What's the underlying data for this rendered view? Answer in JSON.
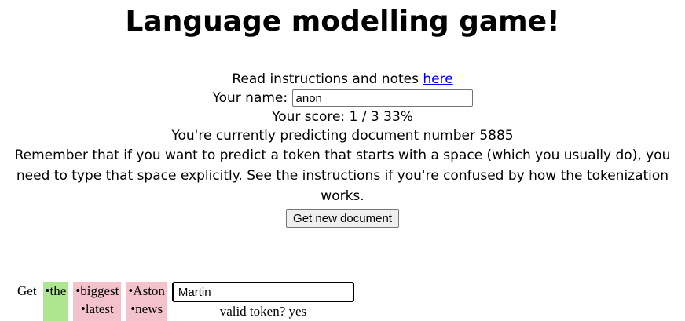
{
  "page": {
    "title": "Language modelling game!"
  },
  "instructions": {
    "prefix": "Read instructions and notes ",
    "link_text": "here"
  },
  "name": {
    "label": "Your name:",
    "value": "anon"
  },
  "score": {
    "text": "Your score: 1 / 3 33%"
  },
  "document": {
    "text": "You're currently predicting document number 5885"
  },
  "remember": {
    "text": "Remember that if you want to predict a token that starts with a space (which you usually do), you need to type that space explicitly. See the instructions if you're confused by how the tokenization works."
  },
  "actions": {
    "new_document_label": "Get new document"
  },
  "tokens": [
    {
      "text": "Get",
      "alt": ""
    },
    {
      "text": "•the",
      "alt": ""
    },
    {
      "text": "•biggest",
      "alt": "•latest"
    },
    {
      "text": "•Aston",
      "alt": "•news"
    }
  ],
  "prediction": {
    "value": "Martin",
    "validity": "valid token? yes"
  },
  "colors": {
    "correct": "#aee68f",
    "incorrect": "#f4c2cb",
    "link": "#0000ee"
  }
}
